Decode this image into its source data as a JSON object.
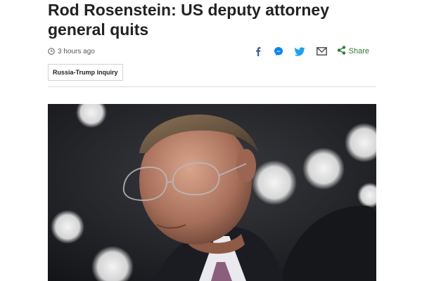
{
  "article": {
    "headline": "Rod Rosenstein: US deputy attorney general quits",
    "timestamp": "3 hours ago",
    "tag": "Russia-Trump inquiry"
  },
  "share": {
    "label": "Share",
    "tools": [
      "facebook-icon",
      "messenger-icon",
      "twitter-icon",
      "email-icon",
      "share-icon"
    ]
  },
  "colors": {
    "facebook": "#3b5998",
    "messenger": "#0084ff",
    "twitter": "#1da1f2",
    "email": "#555555",
    "share": "#2c7d37"
  },
  "hero_image": {
    "alt": "Rod Rosenstein"
  }
}
